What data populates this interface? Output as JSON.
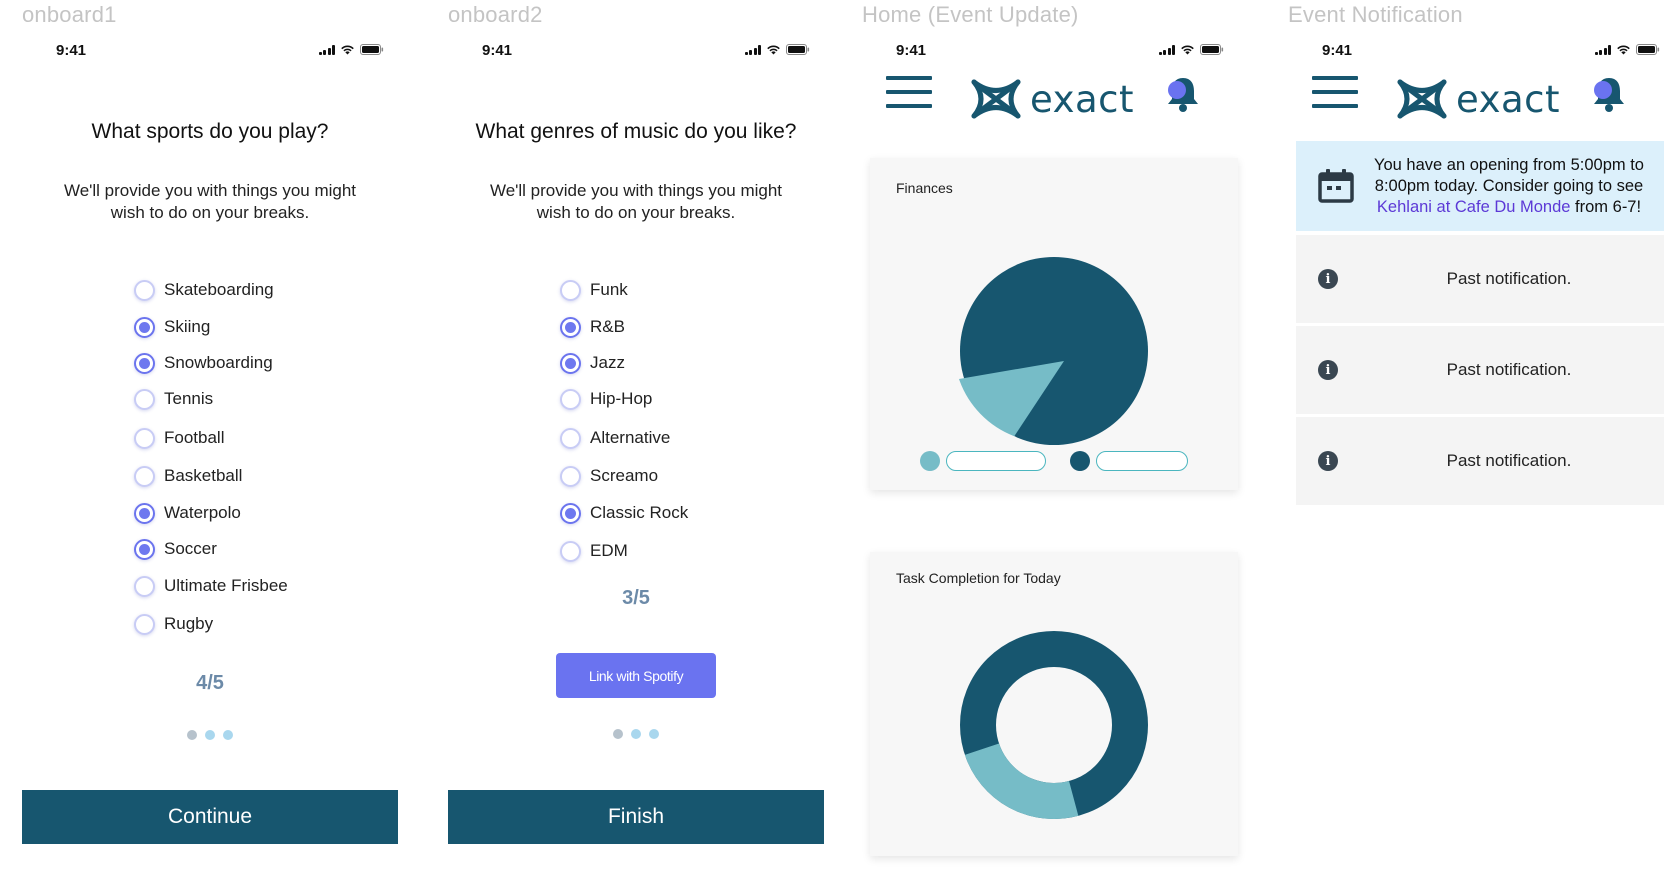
{
  "artboards": [
    "onboard1",
    "onboard2",
    "Home (Event Update)",
    "Event Notification"
  ],
  "status_time": "9:41",
  "onboard1": {
    "question": "What sports do you play?",
    "subtitle": "We'll provide you with things you might wish to do on your breaks.",
    "options": [
      {
        "label": "Skateboarding",
        "checked": false
      },
      {
        "label": "Skiing",
        "checked": true
      },
      {
        "label": "Snowboarding",
        "checked": true
      },
      {
        "label": "Tennis",
        "checked": false
      },
      {
        "label": "Football",
        "checked": false
      },
      {
        "label": "Basketball",
        "checked": false
      },
      {
        "label": "Waterpolo",
        "checked": true
      },
      {
        "label": "Soccer",
        "checked": true
      },
      {
        "label": "Ultimate Frisbee",
        "checked": false
      },
      {
        "label": "Rugby",
        "checked": false
      }
    ],
    "progress": "4/5",
    "button": "Continue"
  },
  "onboard2": {
    "question": "What genres of music do you like?",
    "subtitle": "We'll provide you with things you might wish to do on your breaks.",
    "options": [
      {
        "label": "Funk",
        "checked": false
      },
      {
        "label": "R&B",
        "checked": true
      },
      {
        "label": "Jazz",
        "checked": true
      },
      {
        "label": "Hip-Hop",
        "checked": false
      },
      {
        "label": "Alternative",
        "checked": false
      },
      {
        "label": "Screamo",
        "checked": false
      },
      {
        "label": "Classic Rock",
        "checked": true
      },
      {
        "label": "EDM",
        "checked": false
      }
    ],
    "progress": "3/5",
    "spotify_button": "Link with Spotify",
    "button": "Finish"
  },
  "home": {
    "logo_text": "exact",
    "finances_title": "Finances",
    "finances_fraction_light": 0.31,
    "task_title": "Task Completion for Today",
    "task_fraction_light": 0.24
  },
  "notifications": {
    "logo_text": "exact",
    "highlight": {
      "text_before": "You have an opening from 5:00pm to 8:00pm today. Consider going to see ",
      "link": "Kehlani at Cafe Du Monde",
      "text_after": " from 6-7!"
    },
    "past": [
      "Past notification.",
      "Past notification.",
      "Past notification."
    ]
  },
  "colors": {
    "primary_dark": "#17566f",
    "teal_light": "#76bcc7",
    "accent_purple": "#6a73f0",
    "highlight_bg": "#dcf0fb"
  }
}
